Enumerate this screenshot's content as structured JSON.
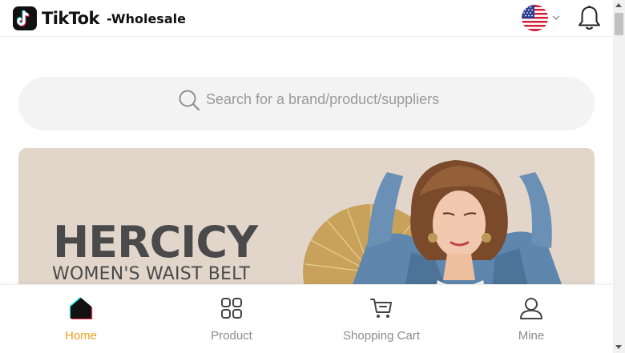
{
  "header": {
    "brand": "TikTok",
    "brand_suffix": "-Wholesale",
    "language_flag_icon": "us-flag-icon",
    "notifications_icon": "bell-icon"
  },
  "search": {
    "placeholder": "Search for a brand/product/suppliers",
    "icon": "search-icon"
  },
  "banner": {
    "title": "HERCICY",
    "subtitle": "WOMEN'S WAIST BELT"
  },
  "tabbar": {
    "items": [
      {
        "label": "Home",
        "icon": "home-icon",
        "active": true
      },
      {
        "label": "Product",
        "icon": "grid-icon",
        "active": false
      },
      {
        "label": "Shopping Cart",
        "icon": "cart-icon",
        "active": false
      },
      {
        "label": "Mine",
        "icon": "user-icon",
        "active": false
      }
    ]
  },
  "colors": {
    "accent": "#f0a020",
    "tab_inactive": "#8c8c8c",
    "search_bg": "#f3f3f3",
    "banner_bg": "#e2d6cb"
  }
}
